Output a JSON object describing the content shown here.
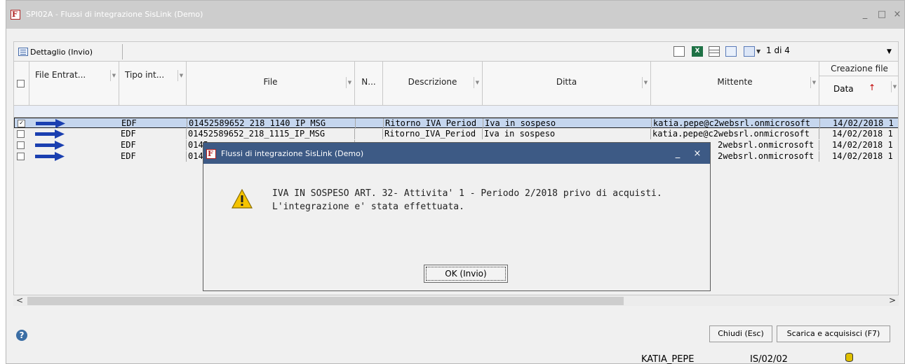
{
  "window": {
    "title": "SPI02A - Flussi di integrazione SisLink  (Demo)",
    "app_icon_letter": "F"
  },
  "toolbar": {
    "detail_button": "Dettaglio (Invio)",
    "pager": "1 di 4"
  },
  "grid": {
    "columns": {
      "file_entrata": "File Entrat...",
      "tipo": "Tipo int...",
      "file": "File",
      "n": "N...",
      "descrizione": "Descrizione",
      "ditta": "Ditta",
      "mittente": "Mittente",
      "creazione_file": "Creazione file",
      "data": "Data"
    },
    "rows": [
      {
        "checked": "✓",
        "tipo": "EDF",
        "file": "01452589652_218_1140_IP_MSG",
        "descrizione": "Ritorno_IVA_Period",
        "ditta": "Iva in sospeso",
        "mittente": "katia.pepe@c2websrl.onmicrosoft",
        "data": "14/02/2018 1"
      },
      {
        "checked": "",
        "tipo": "EDF",
        "file": "01452589652_218_1115_IP_MSG",
        "descrizione": "Ritorno_IVA_Period",
        "ditta": "Iva in sospeso",
        "mittente": "katia.pepe@c2websrl.onmicrosoft",
        "data": "14/02/2018 1"
      },
      {
        "checked": "",
        "tipo": "EDF",
        "file": "0145",
        "descrizione": "",
        "ditta": "",
        "mittente": "2websrl.onmicrosoft",
        "data": "14/02/2018 1"
      },
      {
        "checked": "",
        "tipo": "EDF",
        "file": "0145",
        "descrizione": "",
        "ditta": "",
        "mittente": "2websrl.onmicrosoft",
        "data": "14/02/2018 1"
      }
    ]
  },
  "footer": {
    "close_button": "Chiudi (Esc)",
    "download_button": "Scarica e acquisisci (F7)",
    "user": "KATIA_PEPE",
    "code": "IS/02/02"
  },
  "dialog": {
    "title": "Flussi di integrazione SisLink  (Demo)",
    "line1": "IVA IN SOSPESO ART. 32- Attivita' 1 - Periodo 2/2018 privo di acquisti.",
    "line2": "L'integrazione e' stata effettuata.",
    "ok_button": "OK (Invio)"
  },
  "icons": [
    "app-icon",
    "detail-icon",
    "copy-icon",
    "excel-icon",
    "grid-icon",
    "export-icon",
    "columns-icon",
    "sort-up-icon",
    "arrow-right-icon",
    "warning-icon",
    "help-icon",
    "database-icon"
  ],
  "colors": {
    "title_bar": "#cdcdcd",
    "dialog_title_bar": "#3d5a85",
    "selected_row": "#c5d6ee",
    "arrow": "#1a3fb0"
  }
}
